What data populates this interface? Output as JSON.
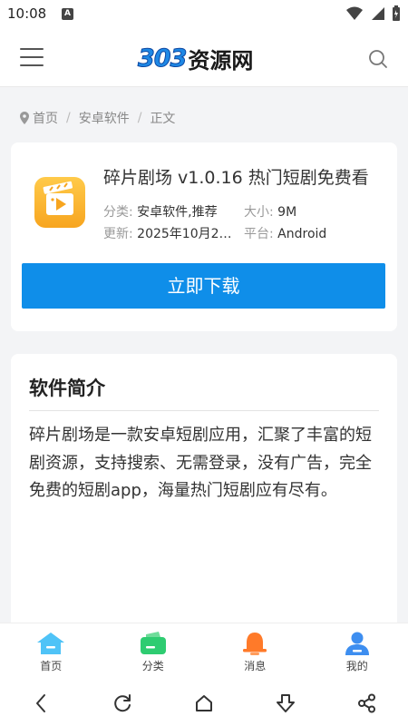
{
  "status_bar": {
    "time": "10:08",
    "notification_badge": "A"
  },
  "header": {
    "logo_number": "303",
    "logo_text": "资源网"
  },
  "breadcrumb": [
    "首页",
    "安卓软件",
    "正文"
  ],
  "app": {
    "title": "碎片剧场 v1.0.16 热门短剧免费看",
    "category_label": "分类:",
    "category_value": "安卓软件,推荐",
    "size_label": "大小:",
    "size_value": "9M",
    "updated_label": "更新:",
    "updated_value": "2025年10月2…",
    "platform_label": "平台:",
    "platform_value": "Android",
    "download_label": "立即下载"
  },
  "intro": {
    "title": "软件简介",
    "text": "碎片剧场是一款安卓短剧应用，汇聚了丰富的短剧资源，支持搜索、无需登录，没有广告，完全免费的短剧app，海量热门短剧应有尽有。"
  },
  "tabbar": [
    {
      "label": "首页",
      "icon": "home-icon",
      "color": "#4fc3f7"
    },
    {
      "label": "分类",
      "icon": "wallet-icon",
      "color": "#2ecc71"
    },
    {
      "label": "消息",
      "icon": "bell-icon",
      "color": "#ff7a29"
    },
    {
      "label": "我的",
      "icon": "user-icon",
      "color": "#3d8ef0"
    }
  ],
  "colors": {
    "accent": "#0f8ee9",
    "app_icon": "#f7a51f"
  }
}
